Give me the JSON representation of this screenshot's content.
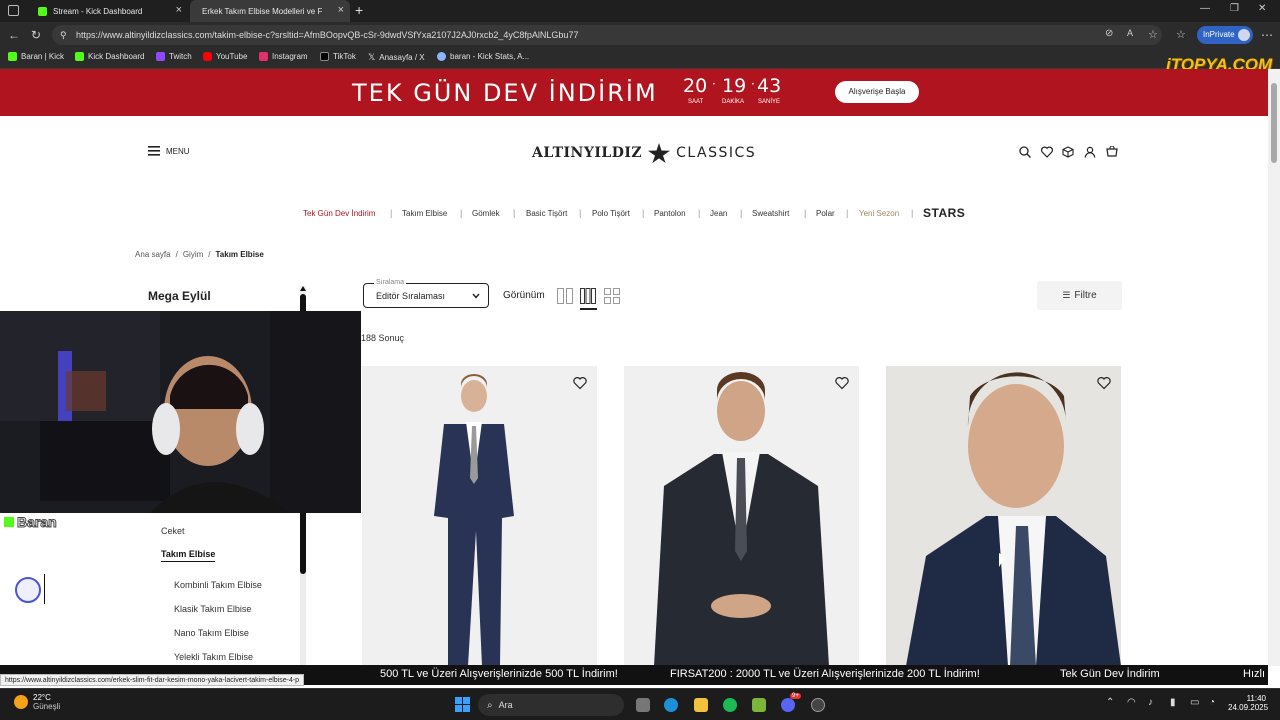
{
  "browser": {
    "tabs": [
      {
        "title": "Stream - Kick Dashboard",
        "active": false
      },
      {
        "title": "Erkek Takım Elbise Modelleri ve F",
        "active": true
      }
    ],
    "new_tab_symbol": "+",
    "url": "https://www.altinyildizclassics.com/takim-elbise-c?srsltid=AfmBOopvQB-cSr-9dwdVSfYxa2107J2AJ0rxcb2_4yC8fpAlNLGbu77",
    "inprivate_label": "InPrivate",
    "bookmarks": [
      {
        "label": "Baran | Kick",
        "color": "#53fc18"
      },
      {
        "label": "Kick Dashboard",
        "color": "#53fc18"
      },
      {
        "label": "Twitch",
        "color": "#9146ff"
      },
      {
        "label": "YouTube",
        "color": "#ff0000"
      },
      {
        "label": "Instagram",
        "color": "#e1306c"
      },
      {
        "label": "TikTok",
        "color": "#ffffff"
      },
      {
        "label": "Anasayfa / X",
        "color": "#ffffff"
      },
      {
        "label": "baran - Kick Stats, A...",
        "color": "#8fb4ff"
      }
    ]
  },
  "watermark": "iTOPYA.COM",
  "promo": {
    "title": "TEK GÜN DEV İNDİRİM",
    "countdown": {
      "hours": "20",
      "minutes": "19",
      "seconds": "43",
      "hours_label": "SAAT",
      "minutes_label": "DAKİKA",
      "seconds_label": "SANİYE"
    },
    "button": "Alışverişe Başla"
  },
  "header": {
    "menu_label": "MENU",
    "logo_left": "ALTINYILDIZ",
    "logo_right": "CLASSICS"
  },
  "categories": [
    {
      "label": "Tek Gün Dev İndirim",
      "color": "#b0151f"
    },
    {
      "label": "Takım Elbise",
      "color": "#333333"
    },
    {
      "label": "Gömlek",
      "color": "#333333"
    },
    {
      "label": "Basic Tişört",
      "color": "#333333"
    },
    {
      "label": "Polo Tişört",
      "color": "#333333"
    },
    {
      "label": "Pantolon",
      "color": "#333333"
    },
    {
      "label": "Jean",
      "color": "#333333"
    },
    {
      "label": "Sweatshirt",
      "color": "#333333"
    },
    {
      "label": "Polar",
      "color": "#333333"
    },
    {
      "label": "Yeni Sezon",
      "color": "#a08a5e"
    },
    {
      "label": "STARS",
      "color": "#222222"
    }
  ],
  "breadcrumb": {
    "items": [
      "Ana sayfa",
      "Giyim",
      "Takım Elbise"
    ],
    "separator": "/"
  },
  "sidebar": {
    "section_title": "Mega Eylül",
    "items": [
      {
        "label": "Ceket"
      },
      {
        "label": "Takım Elbise",
        "active": true
      },
      {
        "label": "Kombinli Takım Elbise"
      },
      {
        "label": "Klasik Takım Elbise"
      },
      {
        "label": "Nano Takım Elbise"
      },
      {
        "label": "Yelekli Takım Elbise"
      }
    ]
  },
  "toolbar": {
    "sort_label": "Sıralama",
    "sort_value": "Editör Sıralaması",
    "view_label": "Görünüm",
    "filter_label": "Filtre"
  },
  "results": {
    "count_text": "188 Sonuç"
  },
  "overlay": {
    "streamer_name": "Baran"
  },
  "ticker": {
    "items": [
      "500 TL ve Üzeri Alışverişlerinizde 500 TL İndirim!",
      "FIRSAT200 : 2000 TL ve Üzeri Alışverişlerinizde 200 TL İndirim!",
      "Tek Gün Dev İndirim",
      "Hızlı"
    ]
  },
  "status_url": "https://www.altinyildizclassics.com/erkek-slim-fit-dar-kesim-mono-yaka-lacivert-takim-elbise-4-p",
  "taskbar": {
    "weather_temp": "22°C",
    "weather_desc": "Güneşli",
    "search_label": "Ara",
    "time": "11:40",
    "date": "24.09.2025",
    "discord_badge": "9+"
  },
  "colors": {
    "brand_red": "#b0151f",
    "edge_blue": "#2f64c4"
  }
}
